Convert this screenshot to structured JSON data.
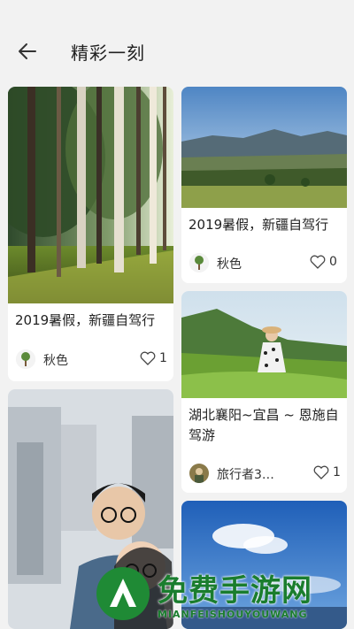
{
  "header": {
    "title": "精彩一刻"
  },
  "cards": [
    {
      "caption": "2019暑假，新疆自驾行",
      "author": "秋色",
      "likes": "1"
    },
    {
      "caption": "2019暑假，新疆自驾行",
      "author": "秋色",
      "likes": "0"
    },
    {
      "caption": "湖北襄阳~宜昌 ~ 恩施自驾游",
      "author": "旅行者3…",
      "likes": "1"
    }
  ],
  "watermark": {
    "title": "免费手游网",
    "subtitle": "MIANFEISHOUYOUWANG"
  }
}
